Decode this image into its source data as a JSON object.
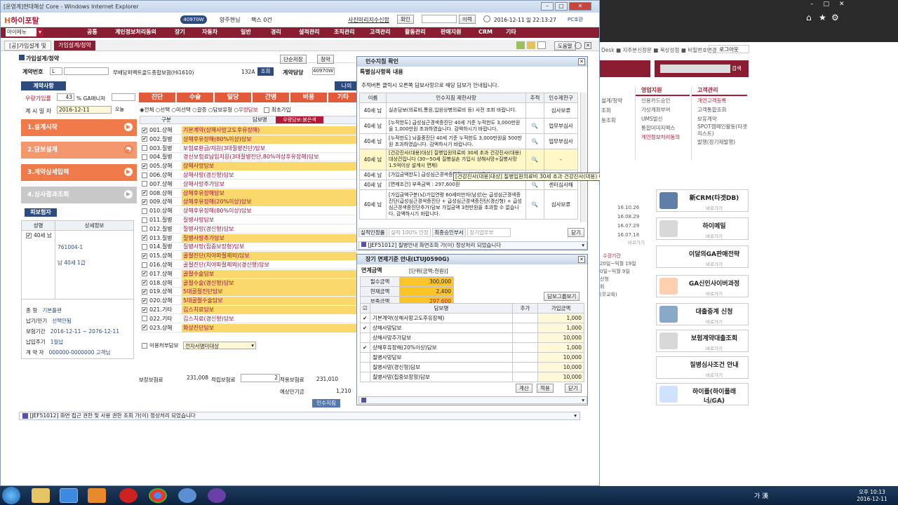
{
  "window_title": "[운영계]현대해상 Core - Windows Internet Explorer",
  "header": {
    "logo": "하이포탈",
    "user_id": "40970W",
    "user_name": "양주현님",
    "fax": "팩스 0건",
    "notice": "사진미리지수신함",
    "confirm_btn": "확인",
    "goto_btn": "이력",
    "datetime": "2016-12-11 일 22:13:27",
    "pcstat": "PC호환"
  },
  "menubar": {
    "my_menu": "마이메뉴",
    "items": [
      "공통",
      "계인정보처리동의",
      "장기",
      "자동차",
      "일반",
      "경리",
      "설적관리",
      "조직관리",
      "고객관리",
      "활동관리",
      "판매지원",
      "CRM",
      "기타"
    ]
  },
  "tabs": [
    "[공]가입설계 및",
    "가입설계/청약"
  ],
  "tabbar_right": {
    "close_all": "도움말"
  },
  "form": {
    "title": "가입설계/청약",
    "btn_save": "단순저장",
    "btn_apply": "청약",
    "contract_no_label": "계약번호",
    "contract_no_prefix": "L",
    "product": "무배당퍼펙트골드종합보험(Hi1610)",
    "product_code": "132A",
    "lookup_btn": "조회",
    "manager_label": "계약담당",
    "manager_id": "40970W",
    "manager_trunc": "양",
    "section_contract": "계약사항",
    "premium_label": "우량가입률",
    "premium_val": "43",
    "ga_label": "% GA매니저",
    "design_date_label": "계 시 일 자",
    "design_date": "2016-12-11",
    "today_btn": "오늘",
    "myself_btn": "나의",
    "steps": [
      "1.설계시작",
      "2.담보설계",
      "3.계약상세입력",
      "4.심사결과조회"
    ],
    "insured_label": "피보험자",
    "insured_cols": [
      "성명",
      "상세정보"
    ],
    "insured_age": "40세 남",
    "insured_code": "761004-1",
    "insured_detail": "남 40세 1급",
    "contract_info": [
      [
        "종 형",
        "기본플랜"
      ],
      [
        "납기/만기",
        "선택안됨"
      ],
      [
        "보험기간",
        "2016-12-11 ~ 2076-12-11"
      ],
      [
        "납입주기",
        "1월납"
      ],
      [
        "계 약 자",
        "000000-0000000 고객님"
      ]
    ],
    "chevrons": [
      "진단",
      "수술",
      "일당",
      "간병",
      "비용",
      "기타"
    ],
    "radios": [
      "전체",
      "선택",
      "미선택",
      "갈증",
      "담보유형",
      "우량담보"
    ],
    "max_label": "최초가입",
    "col_gubun": "구분",
    "col_dambo": "담보명",
    "tag_recommend": "우량담보:붉은색",
    "rows": [
      {
        "code": "001.상해",
        "name": "기본계약(상해사망고도후유장해)",
        "hl": true,
        "chk": "✔"
      },
      {
        "code": "002.질병",
        "name": "상해후유장해(80%이상)담보",
        "hl": true,
        "chk": "✔"
      },
      {
        "code": "003.질병",
        "name": "보험료환급/지원(3대질병진단)담보",
        "hl": false,
        "chk": ""
      },
      {
        "code": "004.질병",
        "name": "경신보험료납입지원(3대질병진단,80%이상후유장해)담보",
        "hl": false,
        "chk": ""
      },
      {
        "code": "005.상해",
        "name": "상해사망담보",
        "hl": true,
        "chk": "✔"
      },
      {
        "code": "006.상해",
        "name": "상해사망(경신형)담보",
        "hl": false,
        "chk": ""
      },
      {
        "code": "007.상해",
        "name": "상해사망추가담보",
        "hl": false,
        "chk": ""
      },
      {
        "code": "008.상해",
        "name": "상해후유장해담보",
        "hl": true,
        "chk": "✔"
      },
      {
        "code": "009.상해",
        "name": "상해후유장해(20%이상)담보",
        "hl": true,
        "chk": "✔"
      },
      {
        "code": "010.상해",
        "name": "상해후유장해(80%이상)담보",
        "hl": false,
        "chk": ""
      },
      {
        "code": "011.질병",
        "name": "질병사망담보",
        "hl": false,
        "chk": ""
      },
      {
        "code": "012.질병",
        "name": "질병사망(경신형)담보",
        "hl": false,
        "chk": ""
      },
      {
        "code": "013.질병",
        "name": "질병사망추가담보",
        "hl": true,
        "chk": "✔"
      },
      {
        "code": "014.질병",
        "name": "질병사망(집중보장형)담보",
        "hl": false,
        "chk": ""
      },
      {
        "code": "015.상해",
        "name": "골절진단(치아파절제외)담보",
        "hl": true,
        "chk": "✔"
      },
      {
        "code": "016.상해",
        "name": "골절진단(치아파절제외)(경신형)담보",
        "hl": false,
        "chk": ""
      },
      {
        "code": "017.상해",
        "name": "골절수술담보",
        "hl": true,
        "chk": "✔"
      },
      {
        "code": "018.상해",
        "name": "골절수술(경신형)담보",
        "hl": true,
        "chk": "✔"
      },
      {
        "code": "019.상해",
        "name": "5대골절진단담보",
        "hl": true,
        "chk": "✔"
      },
      {
        "code": "020.상해",
        "name": "5대골절수술담보",
        "hl": true,
        "chk": "✔"
      },
      {
        "code": "021.기타",
        "name": "깁스치료담보",
        "hl": true,
        "chk": "✔"
      },
      {
        "code": "022.기타",
        "name": "깁스치료(경신형)담보",
        "hl": false,
        "chk": ""
      },
      {
        "code": "023.상해",
        "name": "화상진단담보",
        "hl": true,
        "chk": "✔"
      }
    ],
    "transfer_label": "이용처부담보",
    "transfer_select": "전자서명미대상",
    "premium_total_label": "보장보험료",
    "premium_total": "231,008",
    "accum_label": "적립보험료",
    "accum_val": "2",
    "apply_label": "적용보험료",
    "apply_val": "231,010",
    "estimate_label": "예상만기금",
    "estimate_val": "1,210",
    "bottom_btn": "인수지침",
    "status_msg": "[JEF51012] 화면 접근 권한 및 사용 권한 조회 가(이) 정상처리 되었습니다"
  },
  "dlg1": {
    "title": "인수지침 확인",
    "subtitle": "특별심사항목 내용",
    "desc": "추적버튼 클릭시 오른쪽 담보사항으로 해당 담보가 안내됩니다.",
    "cols": [
      "이름",
      "인수지침 제한사항",
      "추적",
      "인수제한구"
    ],
    "rows": [
      {
        "name": "40세 남",
        "text": "실손담보(의료비,통원,입원상병의료비 등) 사전 조회 바랍니다.",
        "track": "",
        "limit": "심사보류"
      },
      {
        "name": "40세 남",
        "text": "[누적한도] 급성심근경색증진단 40세 기준 누적한도 3,000만원을 1,000만원 초과하였습니다. 감액하시기 바랍니다.",
        "track": "🔍",
        "limit": "업무부심사"
      },
      {
        "name": "40세 남",
        "text": "[누적한도] 뇌졸중진단 40세 기준 누적한도 3,000만원을 500만원 초과하였습니다. 감액하시기 바랍니다.",
        "track": "🔍",
        "limit": "업무부심사"
      },
      {
        "name": "40세 남",
        "text": "[건강진사(대용)대상] 질병입원의료비 30세 초과 건강진사(대용) 대상건입니다 (30~50세 질병실손 가입시 상해사망+질병사망 1.5억이상 설계시 면제)",
        "track": "🔍",
        "limit": "-"
      },
      {
        "name": "40세 남",
        "text": "[가입금액한도] 급성심근경색증진단 보험가입금액",
        "track": "🔍",
        "limit": "한도"
      },
      {
        "name": "40세 남",
        "text": "[면제조건] 부족금액 : 297,600원",
        "track": "🔍",
        "limit": "센터심사해"
      },
      {
        "name": "40세 남",
        "text": "[가입금액구분(뇌)가입연령 60세미만자(남성)는 급성심근경색증진단(급성심근경색증진단 + 급성심근경색증진단(갱신형) + 급성심근경색증진단추가)담보 가입금액 3천만원을 초과할 수 없습니다. 감액하시기 바랍니다.",
        "track": "🔍",
        "limit": "심사보류"
      }
    ],
    "tooltip": "[건강진사(대용)대상] 질병입원의료비 30세 초과 건강진사(대용) 대상건입니다 (30~50세 질병실손 가입시 상해사망+질병사망 1.5억이상 설계시 면제)",
    "perf_label": "실적인정률",
    "perf_val": "실적 100% 인정",
    "dept_label": "최종승인부서",
    "dept_val": "장기업무부",
    "close_btn": "닫기",
    "status": "[JEF51012] 질병안내 화면조회 가(이) 정상처리 되었습니다"
  },
  "dlg2": {
    "title": "장기 면제기준 안내(LTUJ0590G)",
    "sub": "연계금액",
    "unit": "[단위(금액:천원)]",
    "amt_rows": [
      [
        "필수금액",
        "300,000"
      ],
      [
        "현재금액",
        "2,400"
      ],
      [
        "부족금액",
        "297,600"
      ]
    ],
    "detail_btn": "담보그룹보기",
    "cols": [
      "담보명",
      "추가",
      "가입금액"
    ],
    "rows": [
      {
        "chk": "✔",
        "name": "기본계약(상해사망고도후유장해)",
        "amt": "1,000"
      },
      {
        "chk": "✔",
        "name": "상해사망담보",
        "amt": "1,000"
      },
      {
        "chk": "",
        "name": "상해사망추가담보",
        "amt": "10,000"
      },
      {
        "chk": "✔",
        "name": "상해후유장해(20%이상)담보",
        "amt": "1,000"
      },
      {
        "chk": "",
        "name": "질병사망담보",
        "amt": "10,000"
      },
      {
        "chk": "",
        "name": "질병사망(경신형)담보",
        "amt": "10,000"
      },
      {
        "chk": "",
        "name": "질병사망(집중보장형)담보",
        "amt": "10,000"
      }
    ],
    "calc_btn": "계산",
    "apply_btn": "적용",
    "close_btn": "닫기"
  },
  "right": {
    "topnav": "Desk ■ 지주분신장문 ■ 복상성점 ■ 비밀번호변경",
    "logout": "로그아웃",
    "search_btn": "검색",
    "menu_cols": [
      {
        "title": "영업지원",
        "items": [
          "신용카드승인",
          "가상계좌부여",
          "UMS발신",
          "통합미미지팩스",
          "게인정보처리동의"
        ]
      },
      {
        "title": "고객관리",
        "items": [
          "개인고객등록",
          "고객통합조회",
          "보유계약",
          "SPOT캠페인활동(타겟 리스트)",
          "발행(장기제발행)"
        ]
      }
    ],
    "left_frag": [
      "설계/청약",
      "조회",
      "동조회"
    ],
    "dates": [
      "16.10.26",
      "16.08.29",
      "16.07.29",
      "16.07.18"
    ],
    "more": "바로가기",
    "period_label": "수강기간",
    "period1": "20일~익월 19일",
    "period2": "0일~익월 9일",
    "apply_hint": "신청",
    "hint2": "회",
    "hint3": "(무교육)",
    "cards": [
      "新CRM(타겟DB)",
      "하이메일",
      "이달의GA판매전략",
      "GA신인사이버과정",
      "대출중계 신청",
      "보험계약대출조회",
      "질병심사조건 안내",
      "하이플(하이플래너/GA)"
    ],
    "card_more": "바로가기"
  },
  "taskbar": {
    "lang": "가 漢",
    "time": "오후 10:13",
    "date": "2016-12-11"
  }
}
